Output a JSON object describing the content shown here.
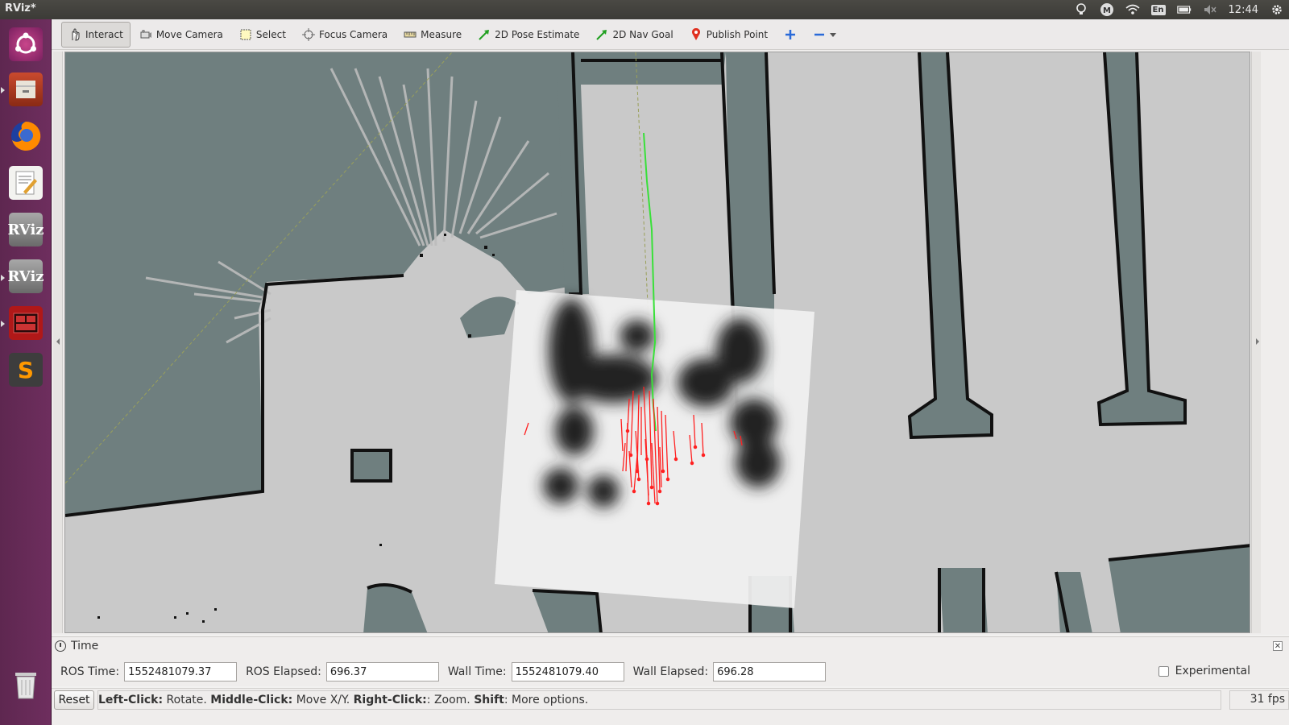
{
  "window": {
    "title": "RViz*"
  },
  "system_tray": {
    "lang": "En",
    "clock": "12:44",
    "icons": [
      "lightbulb-icon",
      "messaging-icon",
      "wifi-icon",
      "keyboard-lang-icon",
      "battery-icon",
      "volume-mute-icon",
      "settings-gear-icon"
    ]
  },
  "launcher": {
    "items": [
      {
        "name": "ubuntu-dash",
        "icon": "ubuntu-logo-icon"
      },
      {
        "name": "files",
        "icon": "file-cabinet-icon"
      },
      {
        "name": "firefox",
        "icon": "firefox-icon"
      },
      {
        "name": "text-editor",
        "icon": "text-editor-icon"
      },
      {
        "name": "rviz-1",
        "icon": "rviz-icon",
        "label": "RViz"
      },
      {
        "name": "rviz-2",
        "icon": "rviz-icon",
        "label": "RViz"
      },
      {
        "name": "terminal",
        "icon": "terminal-icon"
      },
      {
        "name": "sublime-text",
        "icon": "sublime-icon",
        "label": "S"
      },
      {
        "name": "trash",
        "icon": "trash-icon"
      }
    ]
  },
  "toolbar": {
    "interact": "Interact",
    "move_camera": "Move Camera",
    "select": "Select",
    "focus_camera": "Focus Camera",
    "measure": "Measure",
    "pose_estimate": "2D Pose Estimate",
    "nav_goal": "2D Nav Goal",
    "publish_point": "Publish Point"
  },
  "time_panel": {
    "title": "Time",
    "ros_time_label": "ROS Time:",
    "ros_time_value": "1552481079.37",
    "ros_elapsed_label": "ROS Elapsed:",
    "ros_elapsed_value": "696.37",
    "wall_time_label": "Wall Time:",
    "wall_time_value": "1552481079.40",
    "wall_elapsed_label": "Wall Elapsed:",
    "wall_elapsed_value": "696.28",
    "experimental_label": "Experimental"
  },
  "status_bar": {
    "reset_label": "Reset",
    "hint_left_click": "Left-Click:",
    "hint_left_action": " Rotate. ",
    "hint_middle_click": "Middle-Click:",
    "hint_middle_action": " Move X/Y. ",
    "hint_right_click": "Right-Click:",
    "hint_right_action": ": Zoom. ",
    "hint_shift": "Shift",
    "hint_shift_action": ": More options.",
    "fps": "31 fps"
  },
  "colors": {
    "launcher_bg": "#6e2e5e",
    "map_free": "#c9c9c9",
    "map_unknown": "#6f7f7f",
    "map_wall": "#111111",
    "costmap_bg": "#f2f2f2",
    "path_green": "#39e039",
    "particle_red": "#ff2020"
  }
}
